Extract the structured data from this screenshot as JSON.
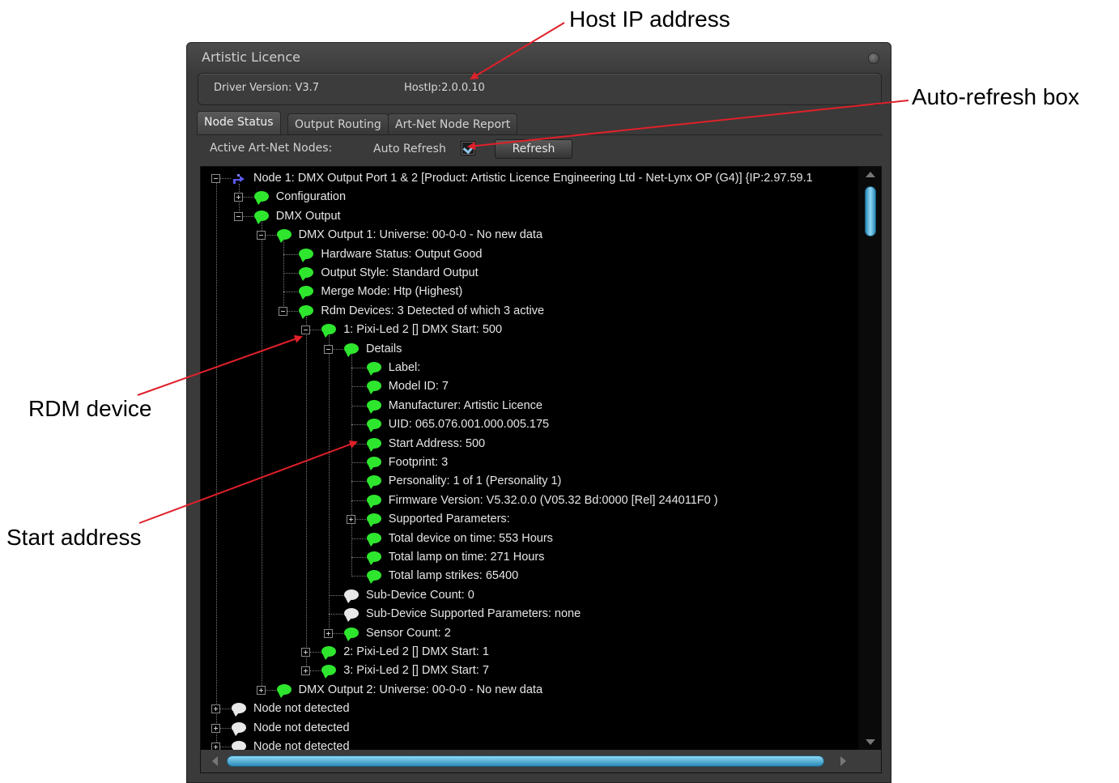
{
  "callouts": {
    "host_ip": "Host IP address",
    "auto_refresh": "Auto-refresh box",
    "rdm_device": "RDM device",
    "start_address": "Start address"
  },
  "window": {
    "title": "Artistic Licence",
    "driver_version": "Driver Version: V3.7",
    "host_ip": "HostIp:2.0.0.10"
  },
  "tabs": [
    "Node Status",
    "Output Routing",
    "Art-Net Node Report"
  ],
  "active_tab": "Node Status",
  "toolbar": {
    "active_nodes_label": "Active Art-Net Nodes:",
    "auto_refresh_label": "Auto Refresh",
    "auto_refresh_checked": true,
    "refresh_button": "Refresh"
  },
  "tree": [
    {
      "level": 0,
      "expander": "minus",
      "icon": "node",
      "text": "Node 1: DMX Output Port 1 & 2 [Product: Artistic Licence Engineering Ltd - Net-Lynx OP (G4)] {IP:2.97.59.1"
    },
    {
      "level": 1,
      "expander": "plus",
      "icon": "green",
      "text": "Configuration"
    },
    {
      "level": 1,
      "expander": "minus",
      "icon": "green",
      "text": "DMX Output"
    },
    {
      "level": 2,
      "expander": "minus",
      "icon": "green",
      "text": "DMX Output 1: Universe: 00-0-0  - No new data"
    },
    {
      "level": 3,
      "expander": "none",
      "icon": "green",
      "text": "Hardware Status: Output Good"
    },
    {
      "level": 3,
      "expander": "none",
      "icon": "green",
      "text": "Output Style: Standard Output"
    },
    {
      "level": 3,
      "expander": "none",
      "icon": "green",
      "text": "Merge Mode: Htp (Highest)"
    },
    {
      "level": 3,
      "expander": "minus",
      "icon": "green",
      "text": "Rdm Devices: 3 Detected of which 3 active"
    },
    {
      "level": 4,
      "expander": "minus",
      "icon": "green",
      "text": "1: Pixi-Led 2 [] DMX Start: 500"
    },
    {
      "level": 5,
      "expander": "minus",
      "icon": "green",
      "text": "Details"
    },
    {
      "level": 6,
      "expander": "none",
      "icon": "green",
      "text": "Label:"
    },
    {
      "level": 6,
      "expander": "none",
      "icon": "green",
      "text": "Model ID: 7"
    },
    {
      "level": 6,
      "expander": "none",
      "icon": "green",
      "text": "Manufacturer: Artistic Licence"
    },
    {
      "level": 6,
      "expander": "none",
      "icon": "green",
      "text": "UID: 065.076.001.000.005.175"
    },
    {
      "level": 6,
      "expander": "none",
      "icon": "green",
      "text": "Start Address: 500"
    },
    {
      "level": 6,
      "expander": "none",
      "icon": "green",
      "text": "Footprint: 3"
    },
    {
      "level": 6,
      "expander": "none",
      "icon": "green",
      "text": "Personality: 1 of 1 (Personality 1)"
    },
    {
      "level": 6,
      "expander": "none",
      "icon": "green",
      "text": "Firmware Version: V5.32.0.0 (V05.32 Bd:0000 [Rel] 244011F0 )"
    },
    {
      "level": 6,
      "expander": "plus",
      "icon": "green",
      "text": "Supported Parameters:"
    },
    {
      "level": 6,
      "expander": "none",
      "icon": "green",
      "text": "Total device on time: 553 Hours"
    },
    {
      "level": 6,
      "expander": "none",
      "icon": "green",
      "text": "Total lamp on time: 271 Hours"
    },
    {
      "level": 6,
      "expander": "none",
      "icon": "green",
      "text": "Total lamp strikes: 65400"
    },
    {
      "level": 5,
      "expander": "none",
      "icon": "white",
      "text": "Sub-Device Count: 0"
    },
    {
      "level": 5,
      "expander": "none",
      "icon": "white",
      "text": "Sub-Device Supported Parameters: none"
    },
    {
      "level": 5,
      "expander": "plus",
      "icon": "green",
      "text": "Sensor Count: 2"
    },
    {
      "level": 4,
      "expander": "plus",
      "icon": "green",
      "text": "2: Pixi-Led 2 [] DMX Start: 1"
    },
    {
      "level": 4,
      "expander": "plus",
      "icon": "green",
      "text": "3: Pixi-Led 2 [] DMX Start: 7"
    },
    {
      "level": 2,
      "expander": "plus",
      "icon": "green",
      "text": "DMX Output 2: Universe: 00-0-0  - No new data"
    },
    {
      "level": 0,
      "expander": "plus",
      "icon": "white",
      "text": "Node not detected"
    },
    {
      "level": 0,
      "expander": "plus",
      "icon": "white",
      "text": "Node not detected"
    },
    {
      "level": 0,
      "expander": "plus",
      "icon": "white",
      "text": "Node not detected"
    }
  ],
  "colors": {
    "status_ok": "#2ee62e",
    "status_inactive": "#e8e8e8",
    "annotation_arrow": "#e0202a",
    "scrollbar_accent": "#8fd8f5"
  }
}
